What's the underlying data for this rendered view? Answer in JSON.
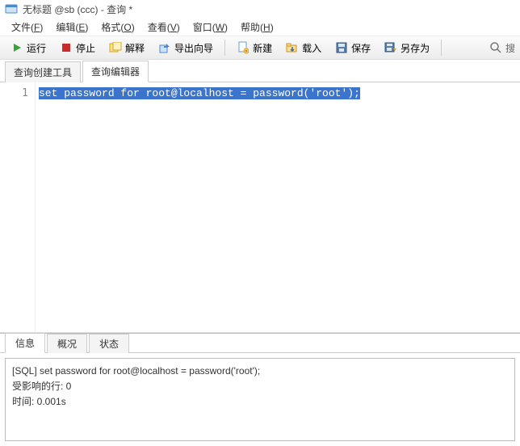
{
  "title": "无标题 @sb (ccc) - 查询 *",
  "menus": {
    "file": "文件(F)",
    "edit": "编辑(E)",
    "format": "格式(O)",
    "view": "查看(V)",
    "window": "窗口(W)",
    "help": "帮助(H)"
  },
  "menu_mnemonics": {
    "file": "F",
    "edit": "E",
    "format": "O",
    "view": "V",
    "window": "W",
    "help": "H"
  },
  "toolbar": {
    "run": "运行",
    "stop": "停止",
    "explain": "解释",
    "export_wizard": "导出向导",
    "new": "新建",
    "load": "载入",
    "save": "保存",
    "save_as": "另存为",
    "search_placeholder": "搜"
  },
  "tabs_upper": {
    "query_builder": "查询创建工具",
    "query_editor": "查询编辑器"
  },
  "active_upper_tab": "query_editor",
  "editor": {
    "line_number": "1",
    "code": "set password for root@localhost = password('root');"
  },
  "tabs_lower": {
    "info": "信息",
    "profile": "概况",
    "status": "状态"
  },
  "active_lower_tab": "info",
  "output": {
    "line1": "[SQL] set password for root@localhost = password('root');",
    "line2": "受影响的行: 0",
    "line3": "时间: 0.001s"
  },
  "colors": {
    "selection_bg": "#3a74cc",
    "selection_fg": "#ffffff",
    "run_green": "#3aa23a",
    "stop_red": "#cc2b2b"
  }
}
